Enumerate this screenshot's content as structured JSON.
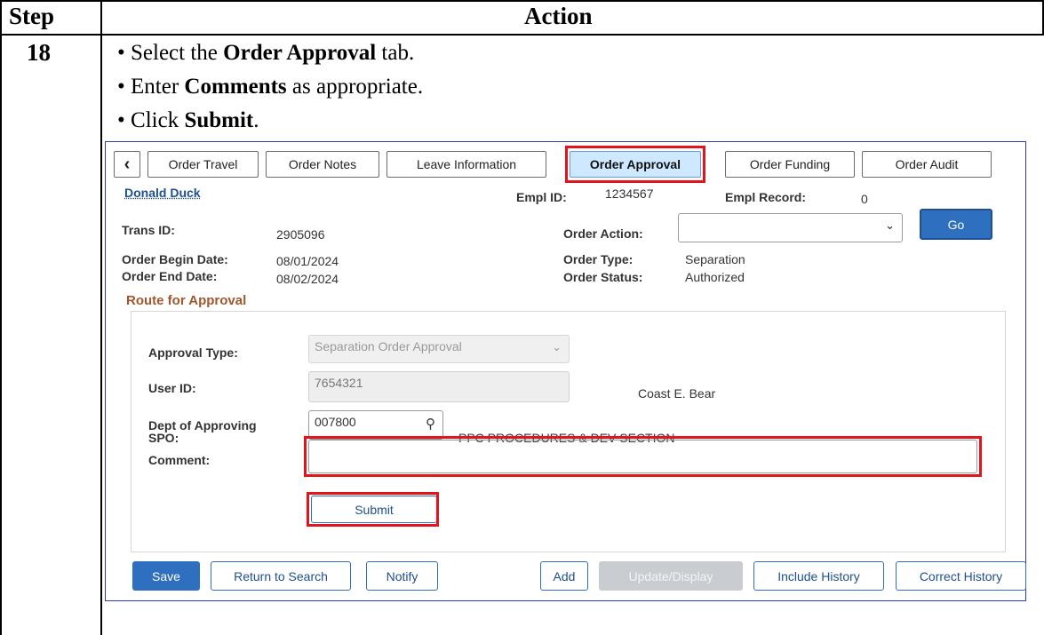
{
  "doc": {
    "header_step": "Step",
    "header_action": "Action",
    "step_number": "18",
    "bullets": [
      {
        "pre": "Select the ",
        "bold": "Order Approval",
        "post": " tab."
      },
      {
        "pre": "Enter ",
        "bold": "Comments",
        "post": " as appropriate."
      },
      {
        "pre": "Click ",
        "bold": "Submit",
        "post": "."
      }
    ]
  },
  "screen": {
    "tabs": [
      "Order Travel",
      "Order Notes",
      "Leave Information",
      "Order Approval",
      "Order Funding",
      "Order Audit"
    ],
    "active_tab": "Order Approval",
    "employee_name": "Donald Duck",
    "empl_id_label": "Empl ID:",
    "empl_id": "1234567",
    "empl_record_label": "Empl Record:",
    "empl_record": "0",
    "trans_id_label": "Trans ID:",
    "trans_id": "2905096",
    "order_action_label": "Order Action:",
    "order_action_value": "",
    "go_label": "Go",
    "begin_date_label": "Order Begin Date:",
    "begin_date": "08/01/2024",
    "end_date_label": "Order End Date:",
    "end_date": "08/02/2024",
    "order_type_label": "Order Type:",
    "order_type": "Separation",
    "order_status_label": "Order Status:",
    "order_status": "Authorized",
    "section_title": "Route for Approval",
    "approval_type_label": "Approval Type:",
    "approval_type": "Separation Order Approval",
    "user_id_label": "User ID:",
    "user_id": "7654321",
    "user_name": "Coast E. Bear",
    "dept_label_1": "Dept of Approving",
    "dept_label_2": "SPO:",
    "dept_value": "007800",
    "dept_name": "PPC PROCEDURES & DEV SECTION",
    "comment_label": "Comment:",
    "comment_value": "",
    "submit_label": "Submit",
    "footer_buttons": {
      "save": "Save",
      "return": "Return to Search",
      "notify": "Notify",
      "add": "Add",
      "update": "Update/Display",
      "include": "Include History",
      "correct": "Correct History"
    },
    "accent_color": "#2f6fbf",
    "highlight_color": "#e3141b"
  }
}
